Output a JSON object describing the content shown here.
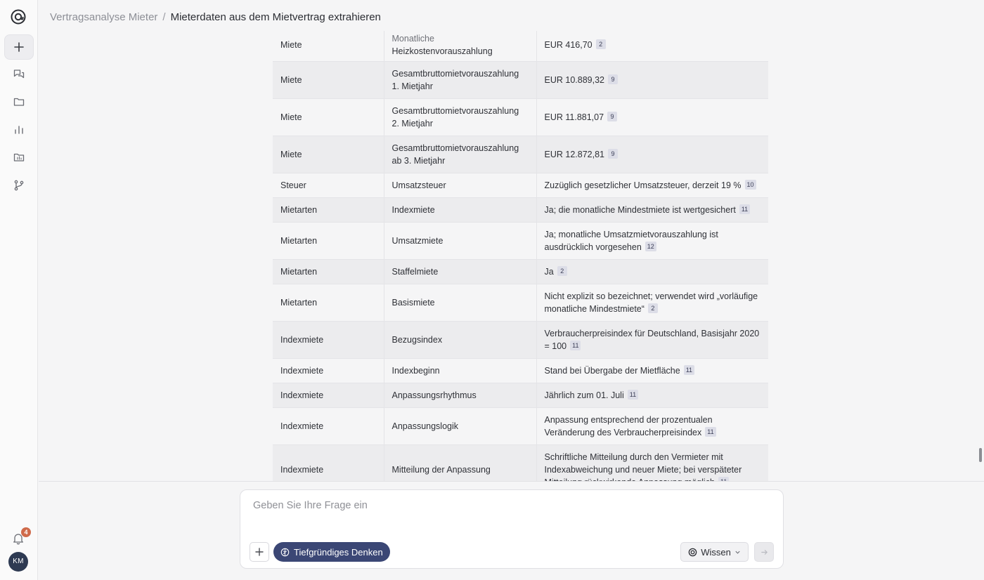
{
  "header": {
    "parent": "Vertragsanalyse Mieter",
    "separator": "/",
    "current": "Mieterdaten aus dem Mietvertrag extrahieren"
  },
  "sidebar": {
    "icons": [
      "new-chat-icon",
      "chats-icon",
      "folder-icon",
      "analytics-icon",
      "archive-icon",
      "workflow-icon"
    ],
    "notification_count": "4",
    "avatar_initials": "KM"
  },
  "table": {
    "rows": [
      {
        "category": "Miete",
        "field": "Monatliche",
        "field_line2": "Heizkostenvorauszahlung",
        "value": "EUR 416,70",
        "ref": "2"
      },
      {
        "category": "Miete",
        "field": "Gesamtbruttomietvorauszahlung 1. Mietjahr",
        "value": "EUR 10.889,32",
        "ref": "9"
      },
      {
        "category": "Miete",
        "field": "Gesamtbruttomietvorauszahlung 2. Mietjahr",
        "value": "EUR 11.881,07",
        "ref": "9"
      },
      {
        "category": "Miete",
        "field": "Gesamtbruttomietvorauszahlung ab 3. Mietjahr",
        "value": "EUR 12.872,81",
        "ref": "9"
      },
      {
        "category": "Steuer",
        "field": "Umsatzsteuer",
        "value": "Zuzüglich gesetzlicher Umsatzsteuer, derzeit 19 %",
        "ref": "10"
      },
      {
        "category": "Mietarten",
        "field": "Indexmiete",
        "value": "Ja; die monatliche Mindestmiete ist wertgesichert",
        "ref": "11"
      },
      {
        "category": "Mietarten",
        "field": "Umsatzmiete",
        "value": "Ja; monatliche Umsatzmietvorauszahlung ist ausdrücklich vorgesehen",
        "ref": "12"
      },
      {
        "category": "Mietarten",
        "field": "Staffelmiete",
        "value": "Ja",
        "ref": "2"
      },
      {
        "category": "Mietarten",
        "field": "Basismiete",
        "value": "Nicht explizit so bezeichnet; verwendet wird „vorläufige monatliche Mindestmiete“",
        "ref": "2"
      },
      {
        "category": "Indexmiete",
        "field": "Bezugsindex",
        "value": "Verbraucherpreisindex für Deutschland, Basisjahr 2020 = 100",
        "ref": "11"
      },
      {
        "category": "Indexmiete",
        "field": "Indexbeginn",
        "value": "Stand bei Übergabe der Mietfläche",
        "ref": "11"
      },
      {
        "category": "Indexmiete",
        "field": "Anpassungsrhythmus",
        "value": "Jährlich zum 01. Juli",
        "ref": "11"
      },
      {
        "category": "Indexmiete",
        "field": "Anpassungslogik",
        "value": "Anpassung entsprechend der prozentualen Veränderung des Verbraucherpreisindex",
        "ref": "11"
      },
      {
        "category": "Indexmiete",
        "field": "Mitteilung der Anpassung",
        "value": "Schriftliche Mitteilung durch den Vermieter mit Indexabweichung und neuer Miete; bei verspäteter Mitteilung rückwirkende Anpassung möglich",
        "ref": "11"
      }
    ]
  },
  "composer": {
    "placeholder": "Geben Sie Ihre Frage ein",
    "deep_think_label": "Tiefgründiges Denken",
    "knowledge_label": "Wissen"
  }
}
